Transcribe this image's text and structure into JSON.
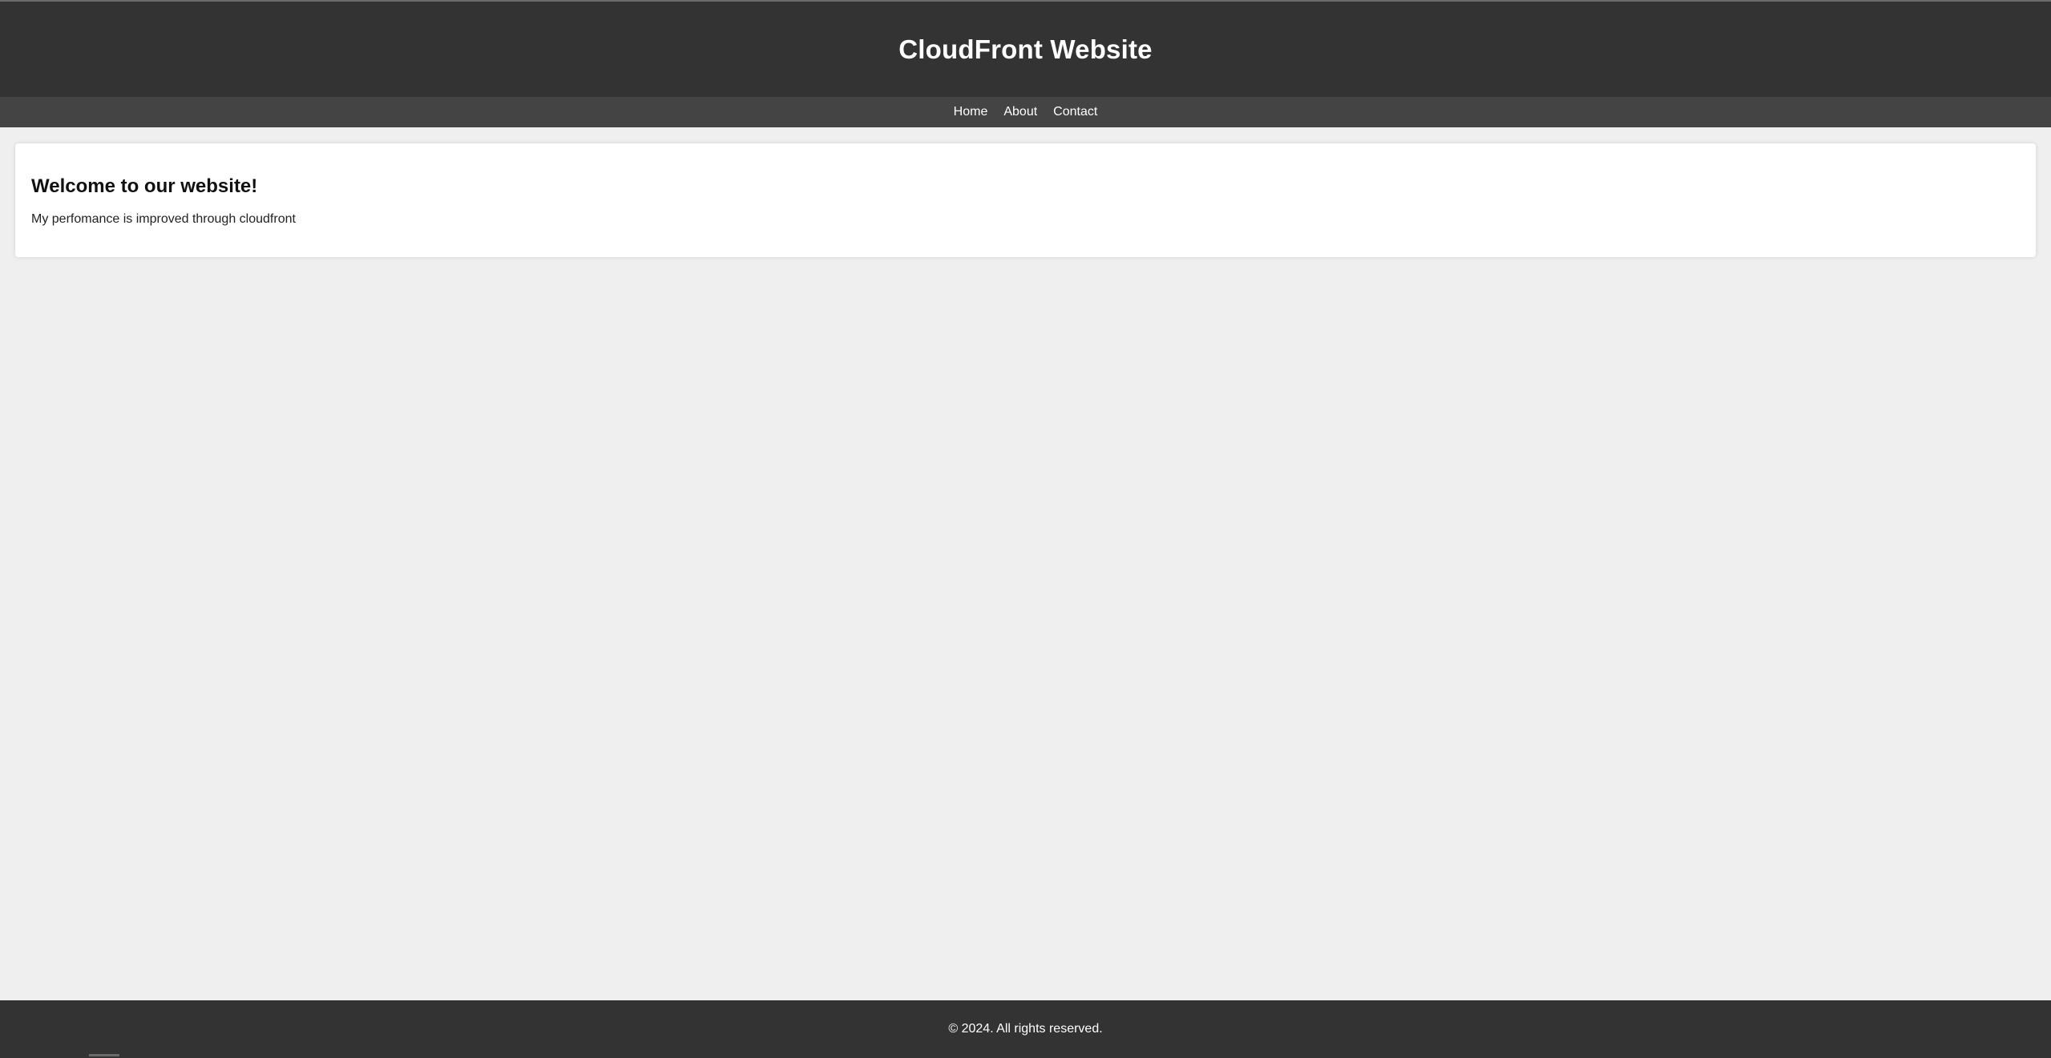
{
  "header": {
    "title": "CloudFront Website"
  },
  "nav": {
    "items": [
      {
        "label": "Home"
      },
      {
        "label": "About"
      },
      {
        "label": "Contact"
      }
    ]
  },
  "main": {
    "heading": "Welcome to our website!",
    "body": "My perfomance is improved through cloudfront"
  },
  "footer": {
    "text": "© 2024. All rights reserved."
  },
  "colors": {
    "page_background": "#efefef",
    "header_background": "#333333",
    "nav_background": "#444444",
    "card_background": "#ffffff",
    "text_light": "#ffffff"
  }
}
